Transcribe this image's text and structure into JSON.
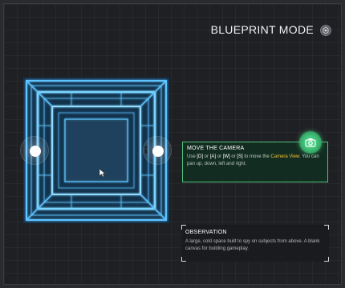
{
  "header": {
    "mode_title": "BLUEPRINT MODE",
    "mode_icon": "settings-circle-icon"
  },
  "blueprint": {
    "description_icon": "room-blueprint",
    "accent_color": "#4fb6ff",
    "nodes": [
      "left-node",
      "right-node"
    ]
  },
  "tutorial": {
    "title": "MOVE THE CAMERA",
    "text_use": "Use ",
    "key_d": "[D]",
    "or1": " or ",
    "key_a": "[A]",
    "or2": " or ",
    "key_w": "[W]",
    "or3": " or ",
    "key_s": "[S]",
    "text_to_move": " to move the ",
    "highlight": "Camera View",
    "text_end": ". You can pan up, down, left and right.",
    "badge_icon": "camera-icon",
    "accent_color": "#4fbf7a",
    "highlight_color": "#f1c232"
  },
  "observation": {
    "title": "OBSERVATION",
    "text": "A large, cold space built to spy on subjects from above. A blank canvas for building gameplay."
  }
}
